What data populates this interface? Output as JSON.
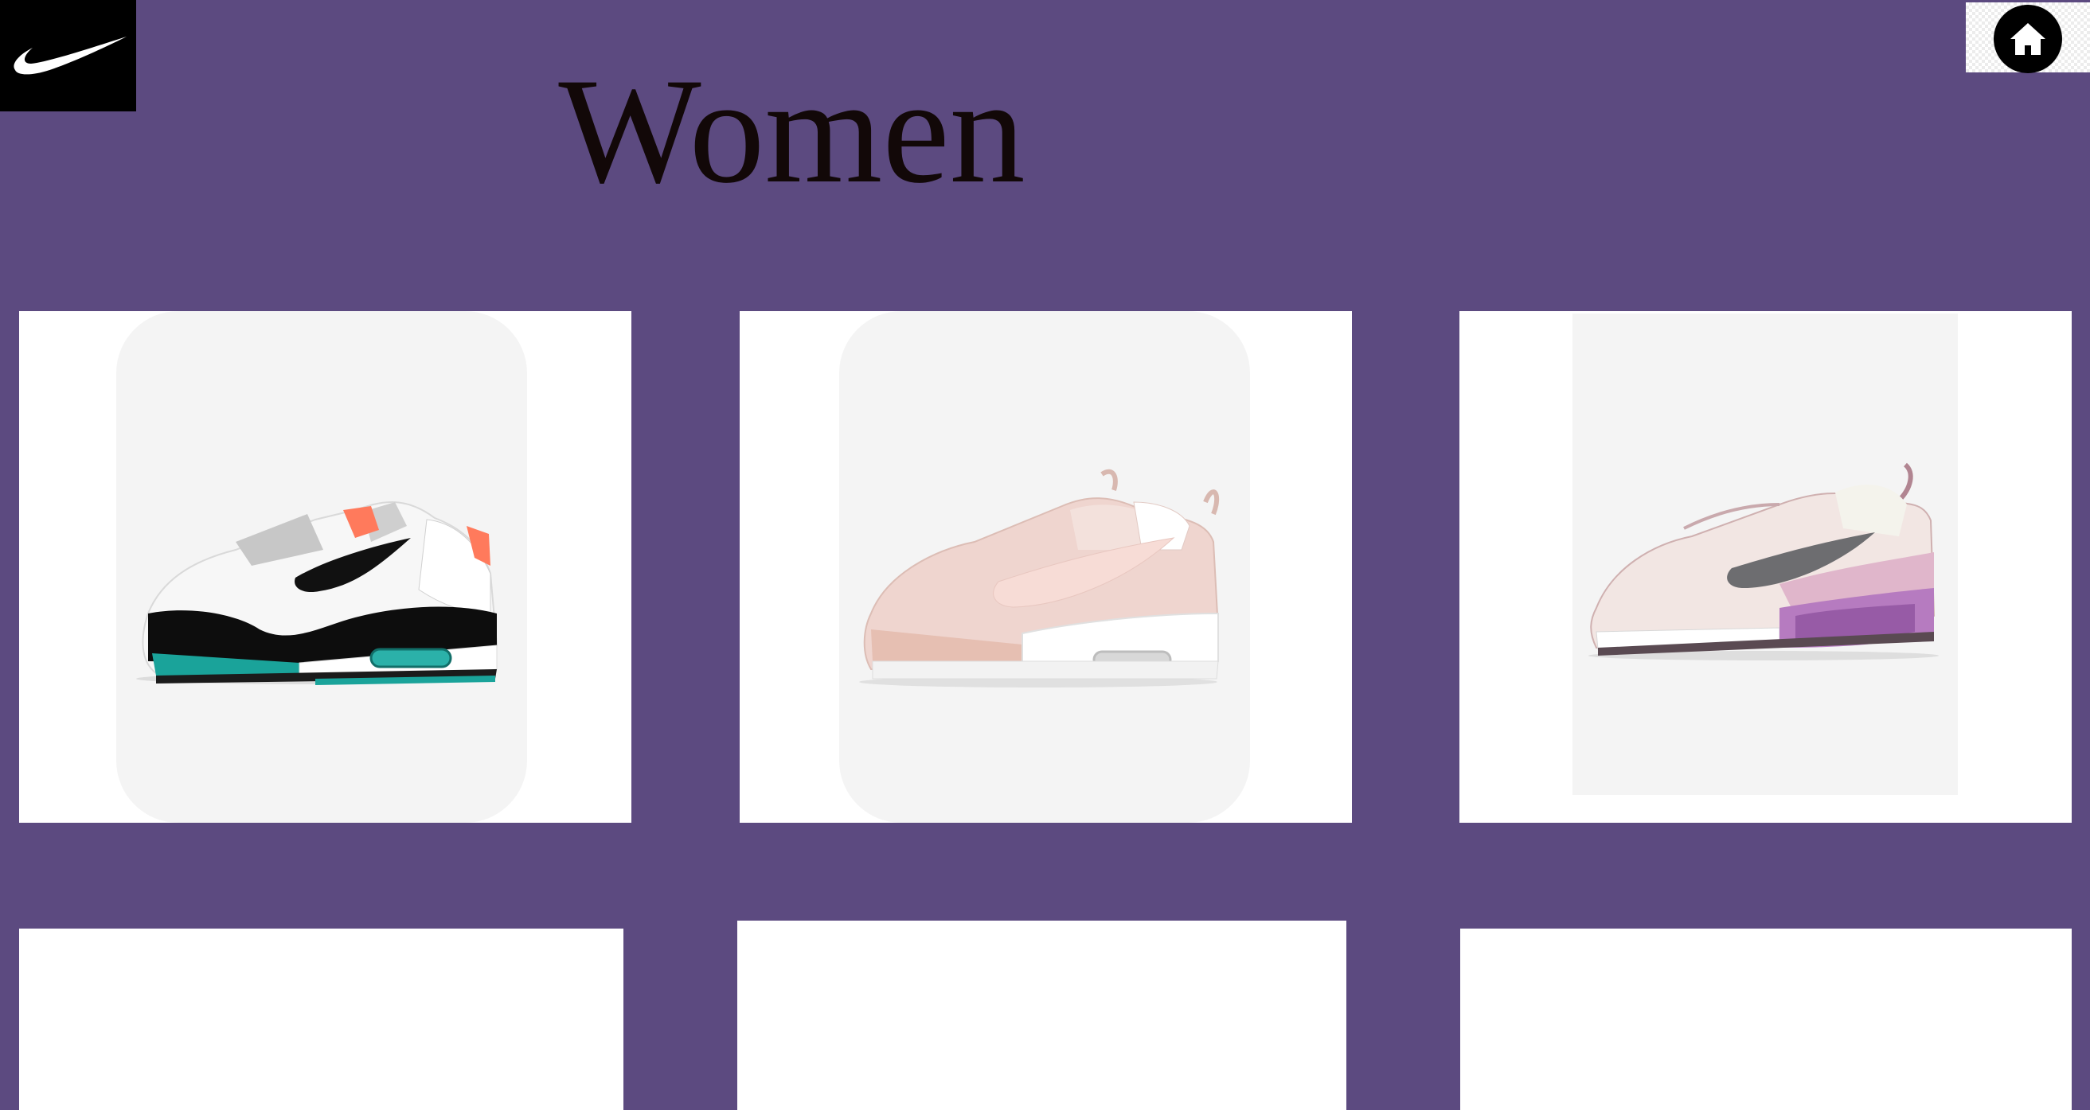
{
  "header": {
    "title": "Women",
    "logo_icon": "nike-swoosh-logo",
    "home_icon": "home-icon"
  },
  "colors": {
    "page_background": "#5c4a80",
    "card_background": "#ffffff",
    "shoe_backdrop": "#f4f4f4"
  },
  "products": [
    {
      "name": "product-card-1",
      "image": "white-black-teal-air-max-sneaker"
    },
    {
      "name": "product-card-2",
      "image": "pink-air-max-90-futura-sneaker"
    },
    {
      "name": "product-card-3",
      "image": "light-pink-lilac-air-max-2021-sneaker"
    },
    {
      "name": "product-card-4",
      "image": "empty"
    },
    {
      "name": "product-card-5",
      "image": "empty"
    },
    {
      "name": "product-card-6",
      "image": "empty"
    }
  ]
}
